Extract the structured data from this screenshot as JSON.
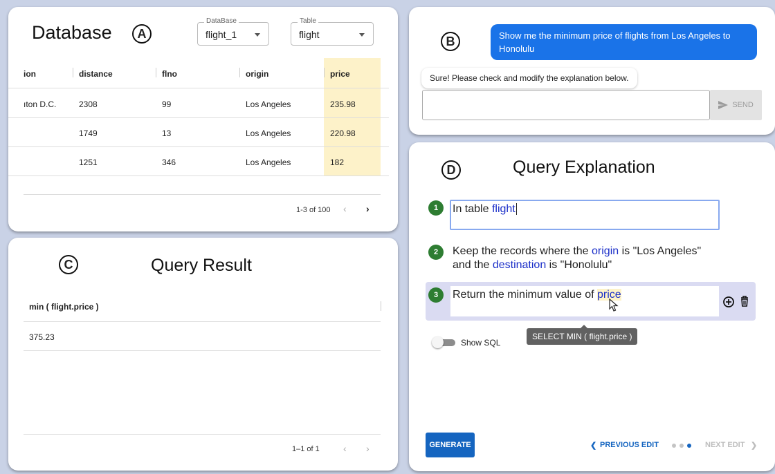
{
  "panel_a": {
    "title": "Database",
    "marker": "A",
    "database_select": {
      "label": "DataBase",
      "value": "flight_1"
    },
    "table_select": {
      "label": "Table",
      "value": "flight"
    },
    "columns": [
      "ion",
      "distance",
      "flno",
      "origin",
      "price"
    ],
    "rows": [
      [
        "ıton D.C.",
        "2308",
        "99",
        "Los Angeles",
        "235.98"
      ],
      [
        "",
        "1749",
        "13",
        "Los Angeles",
        "220.98"
      ],
      [
        "",
        "1251",
        "346",
        "Los Angeles",
        "182"
      ]
    ],
    "highlight_color": "#fdf2c9",
    "pagination": "1-3 of 100"
  },
  "panel_b": {
    "marker": "B",
    "user_message": "Show me the minimum price of flights from Los Angeles to Honolulu",
    "bot_message": "Sure! Please check and modify the explanation below.",
    "input_value": "",
    "send_label": "SEND",
    "accent_color": "#1a73e8"
  },
  "panel_c": {
    "marker": "C",
    "title": "Query Result",
    "column": "min ( flight.price )",
    "value": "375.23",
    "pagination": "1–1 of 1"
  },
  "panel_d": {
    "marker": "D",
    "title": "Query Explanation",
    "steps": [
      {
        "num": "1",
        "plain1": "In table ",
        "kw1": "flight"
      },
      {
        "num": "2",
        "plain1": "Keep the records where the ",
        "kw1": "origin",
        "plain2": " is \"Los Angeles\"",
        "plain3": "and the ",
        "kw2": "destination",
        "plain4": " is \"Honolulu\""
      },
      {
        "num": "3",
        "plain1": "Return the minimum value of ",
        "kw1": "price"
      }
    ],
    "tooltip": "SELECT MIN ( flight.price )",
    "show_sql_label": "Show SQL",
    "generate_label": "GENERATE",
    "previous_label": "PREVIOUS EDIT",
    "next_label": "NEXT EDIT",
    "step_color": "#2e7d32",
    "keyword_color": "#1a2ec8"
  }
}
